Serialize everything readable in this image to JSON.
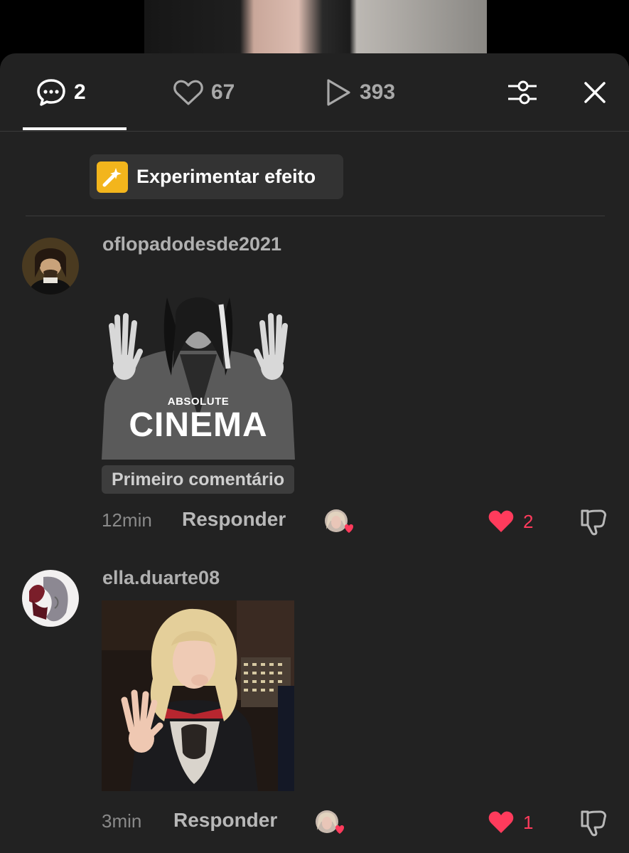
{
  "tabs": {
    "comments_count": "2",
    "likes_count": "67",
    "plays_count": "393"
  },
  "effect": {
    "label": "Experimentar efeito"
  },
  "comments": [
    {
      "username": "oflopadodesde2021",
      "gif_caption_small": "ABSOLUTE",
      "gif_caption_big": "CINEMA",
      "badge": "Primeiro comentário",
      "time": "12min",
      "reply_label": "Responder",
      "likes": "2"
    },
    {
      "username": "ella.duarte08",
      "time": "3min",
      "reply_label": "Responder",
      "likes": "1"
    }
  ],
  "colors": {
    "sheet_bg": "#222222",
    "like_red": "#ff3b5c",
    "effect_yellow": "#f3b51c"
  }
}
